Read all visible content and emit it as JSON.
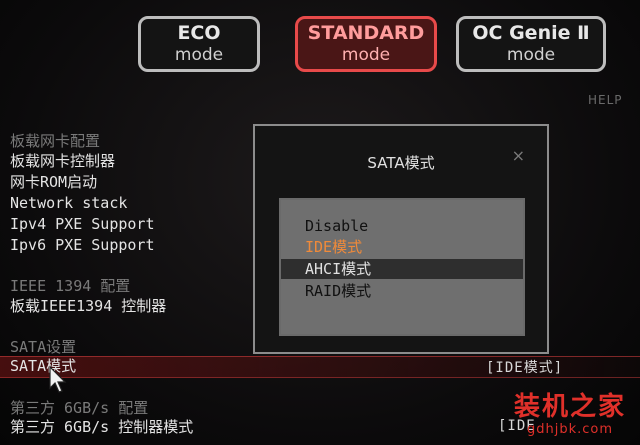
{
  "modes": [
    {
      "line1": "ECO",
      "line2": "mode"
    },
    {
      "line1": "STANDARD",
      "line2": "mode"
    },
    {
      "line1": "OC Genie Ⅱ",
      "line2": "mode"
    }
  ],
  "help": "HELP",
  "menu": {
    "onboard_lan_header": "板载网卡配置",
    "onboard_lan_controller": "板载网卡控制器",
    "lan_rom": "网卡ROM启动",
    "network_stack": "Network stack",
    "ipv4_pxe": "Ipv4 PXE Support",
    "ipv6_pxe": "Ipv6 PXE Support",
    "ieee_header": "IEEE 1394 配置",
    "ieee_controller": "板载IEEE1394 控制器",
    "sata_header": "SATA设置",
    "sata_mode": "SATA模式",
    "sata_mode_value": "[IDE模式]",
    "third_party_header": "第三方 6GB/s 配置",
    "third_party_mode": "第三方 6GB/s 控制器模式",
    "third_party_value": "[IDE"
  },
  "dialog": {
    "title": "SATA模式",
    "close": "×",
    "options": [
      "Disable",
      "IDE模式",
      "AHCI模式",
      "RAID模式"
    ]
  },
  "watermark": {
    "line1": "装机之家",
    "line2": "gdhjbk.com"
  }
}
